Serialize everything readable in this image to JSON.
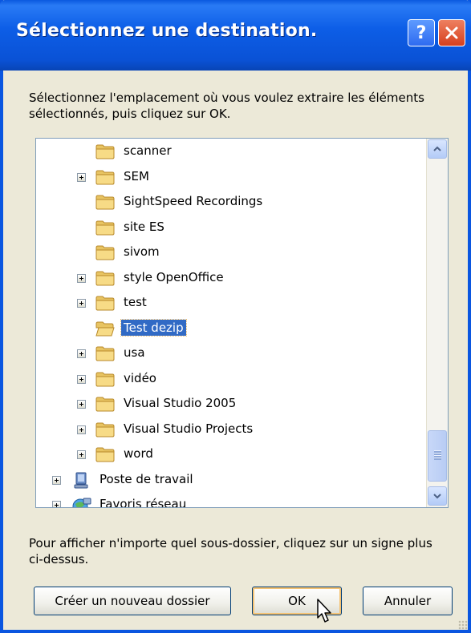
{
  "window": {
    "title": "Sélectionnez une destination.",
    "help_label": "?"
  },
  "description": "Sélectionnez l'emplacement où vous voulez extraire les éléments sélectionnés, puis cliquez sur OK.",
  "tree": {
    "items": [
      {
        "label": "scanner",
        "expandable": false,
        "selected": false,
        "icon": "folder-icon"
      },
      {
        "label": "SEM",
        "expandable": true,
        "selected": false,
        "icon": "folder-icon"
      },
      {
        "label": "SightSpeed Recordings",
        "expandable": false,
        "selected": false,
        "icon": "folder-icon"
      },
      {
        "label": "site ES",
        "expandable": false,
        "selected": false,
        "icon": "folder-icon"
      },
      {
        "label": "sivom",
        "expandable": false,
        "selected": false,
        "icon": "folder-icon"
      },
      {
        "label": "style OpenOffice",
        "expandable": true,
        "selected": false,
        "icon": "folder-icon"
      },
      {
        "label": "test",
        "expandable": true,
        "selected": false,
        "icon": "folder-icon"
      },
      {
        "label": "Test dezip",
        "expandable": false,
        "selected": true,
        "icon": "open-folder-icon"
      },
      {
        "label": "usa",
        "expandable": true,
        "selected": false,
        "icon": "folder-icon"
      },
      {
        "label": "vidéo",
        "expandable": true,
        "selected": false,
        "icon": "folder-icon"
      },
      {
        "label": "Visual Studio 2005",
        "expandable": true,
        "selected": false,
        "icon": "folder-icon"
      },
      {
        "label": "Visual Studio Projects",
        "expandable": true,
        "selected": false,
        "icon": "folder-icon"
      },
      {
        "label": "word",
        "expandable": true,
        "selected": false,
        "icon": "folder-icon"
      },
      {
        "label": "Poste de travail",
        "expandable": true,
        "selected": false,
        "icon": "computer-icon"
      },
      {
        "label": "Favoris réseau",
        "expandable": true,
        "selected": false,
        "icon": "network-icon"
      }
    ]
  },
  "hint": "Pour afficher n'importe quel sous-dossier, cliquez sur un signe plus ci-dessus.",
  "buttons": {
    "new_folder": "Créer un nouveau dossier",
    "ok": "OK",
    "cancel": "Annuler"
  },
  "colors": {
    "titlebar": "#0A5BE2",
    "selection": "#316AC5",
    "window_bg": "#ECE9D8"
  }
}
